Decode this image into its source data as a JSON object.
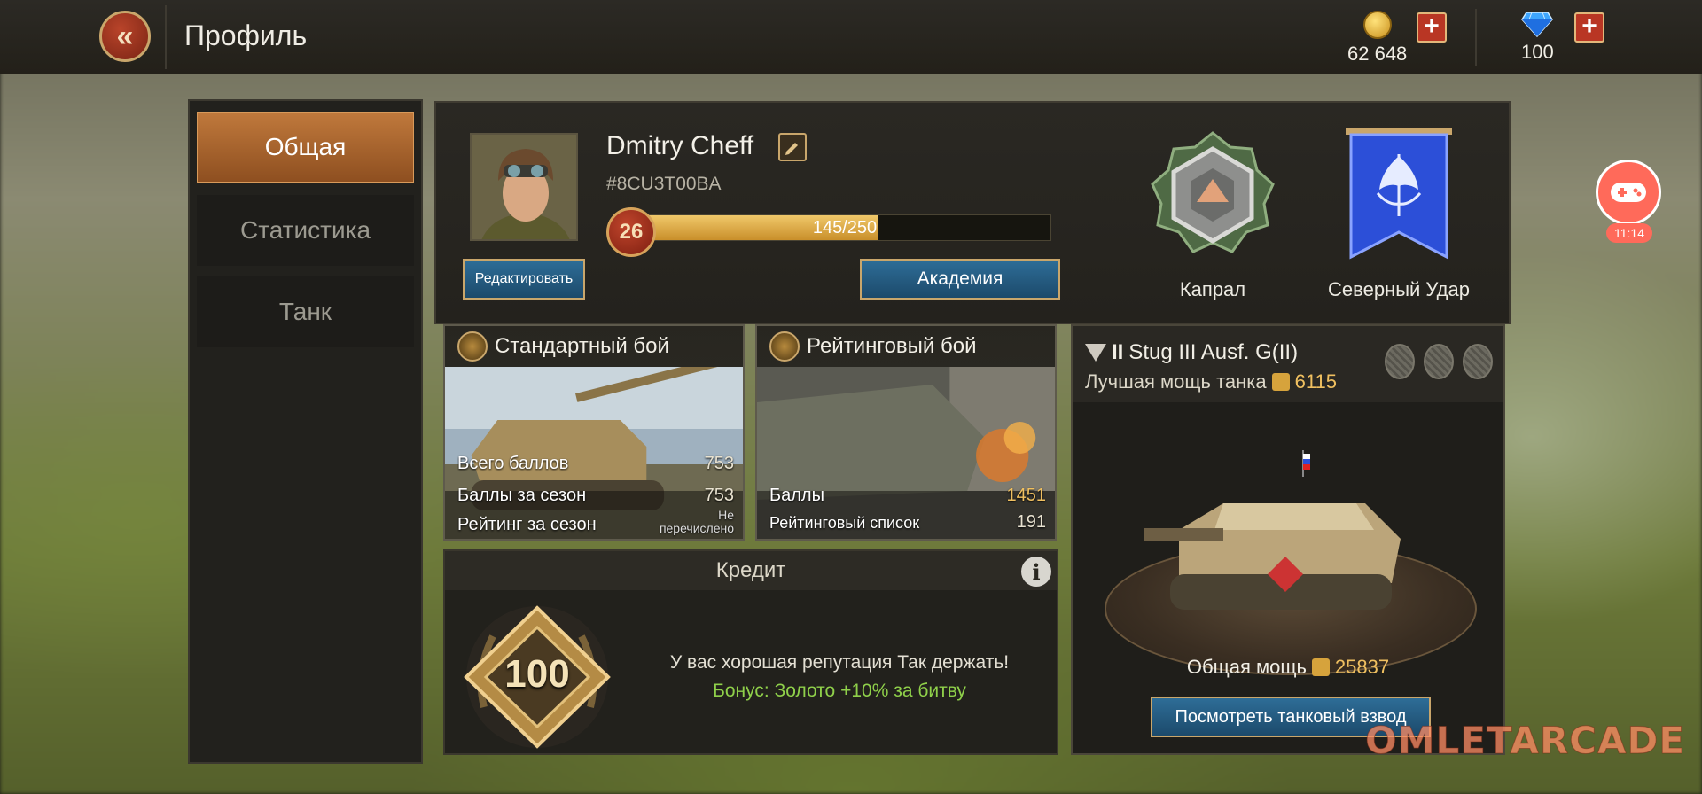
{
  "header": {
    "title": "Профиль",
    "gold": "62 648",
    "gems": "100"
  },
  "nav": {
    "items": [
      {
        "label": "Общая"
      },
      {
        "label": "Статистика"
      },
      {
        "label": "Танк"
      }
    ],
    "active": "Общая"
  },
  "profile": {
    "name": "Dmitry Cheff",
    "id": "#8CU3T00BA",
    "level": "26",
    "xp_text": "145/250",
    "xp_fraction": 0.58,
    "edit_label": "Редактировать",
    "academy_label": "Академия",
    "rank": "Капрал",
    "clan": "Северный Удар"
  },
  "standard_battle": {
    "title": "Стандартный бой",
    "rows": [
      {
        "label": "Всего баллов",
        "value": "753"
      },
      {
        "label": "Баллы за сезон",
        "value": "753"
      },
      {
        "label": "Рейтинг за сезон",
        "value_line1": "Не",
        "value_line2": "перечислено"
      }
    ]
  },
  "ranked_battle": {
    "title": "Рейтинговый бой",
    "rows": [
      {
        "label": "Баллы",
        "value": "1451"
      },
      {
        "label": "Рейтинговый список",
        "value": "191"
      }
    ]
  },
  "credit": {
    "title": "Кредит",
    "score": "100",
    "message": "У вас хорошая репутация Так держать!",
    "bonus": "Бонус: Золото +10% за битву"
  },
  "tank": {
    "tier": "II",
    "name": "Stug III Ausf. G(II)",
    "best_label": "Лучшая мощь танка",
    "best_value": "6115",
    "total_label": "Общая мощь",
    "total_value": "25837",
    "platoon_button": "Посмотреть танковый взвод"
  },
  "overlay": {
    "clock": "11:14",
    "watermark": "OMLETARCADE"
  },
  "colors": {
    "accent_gold": "#c9a66b",
    "active_tab": "#b06a30",
    "button_blue": "#2a6185",
    "bonus_green": "#8fd04a"
  }
}
